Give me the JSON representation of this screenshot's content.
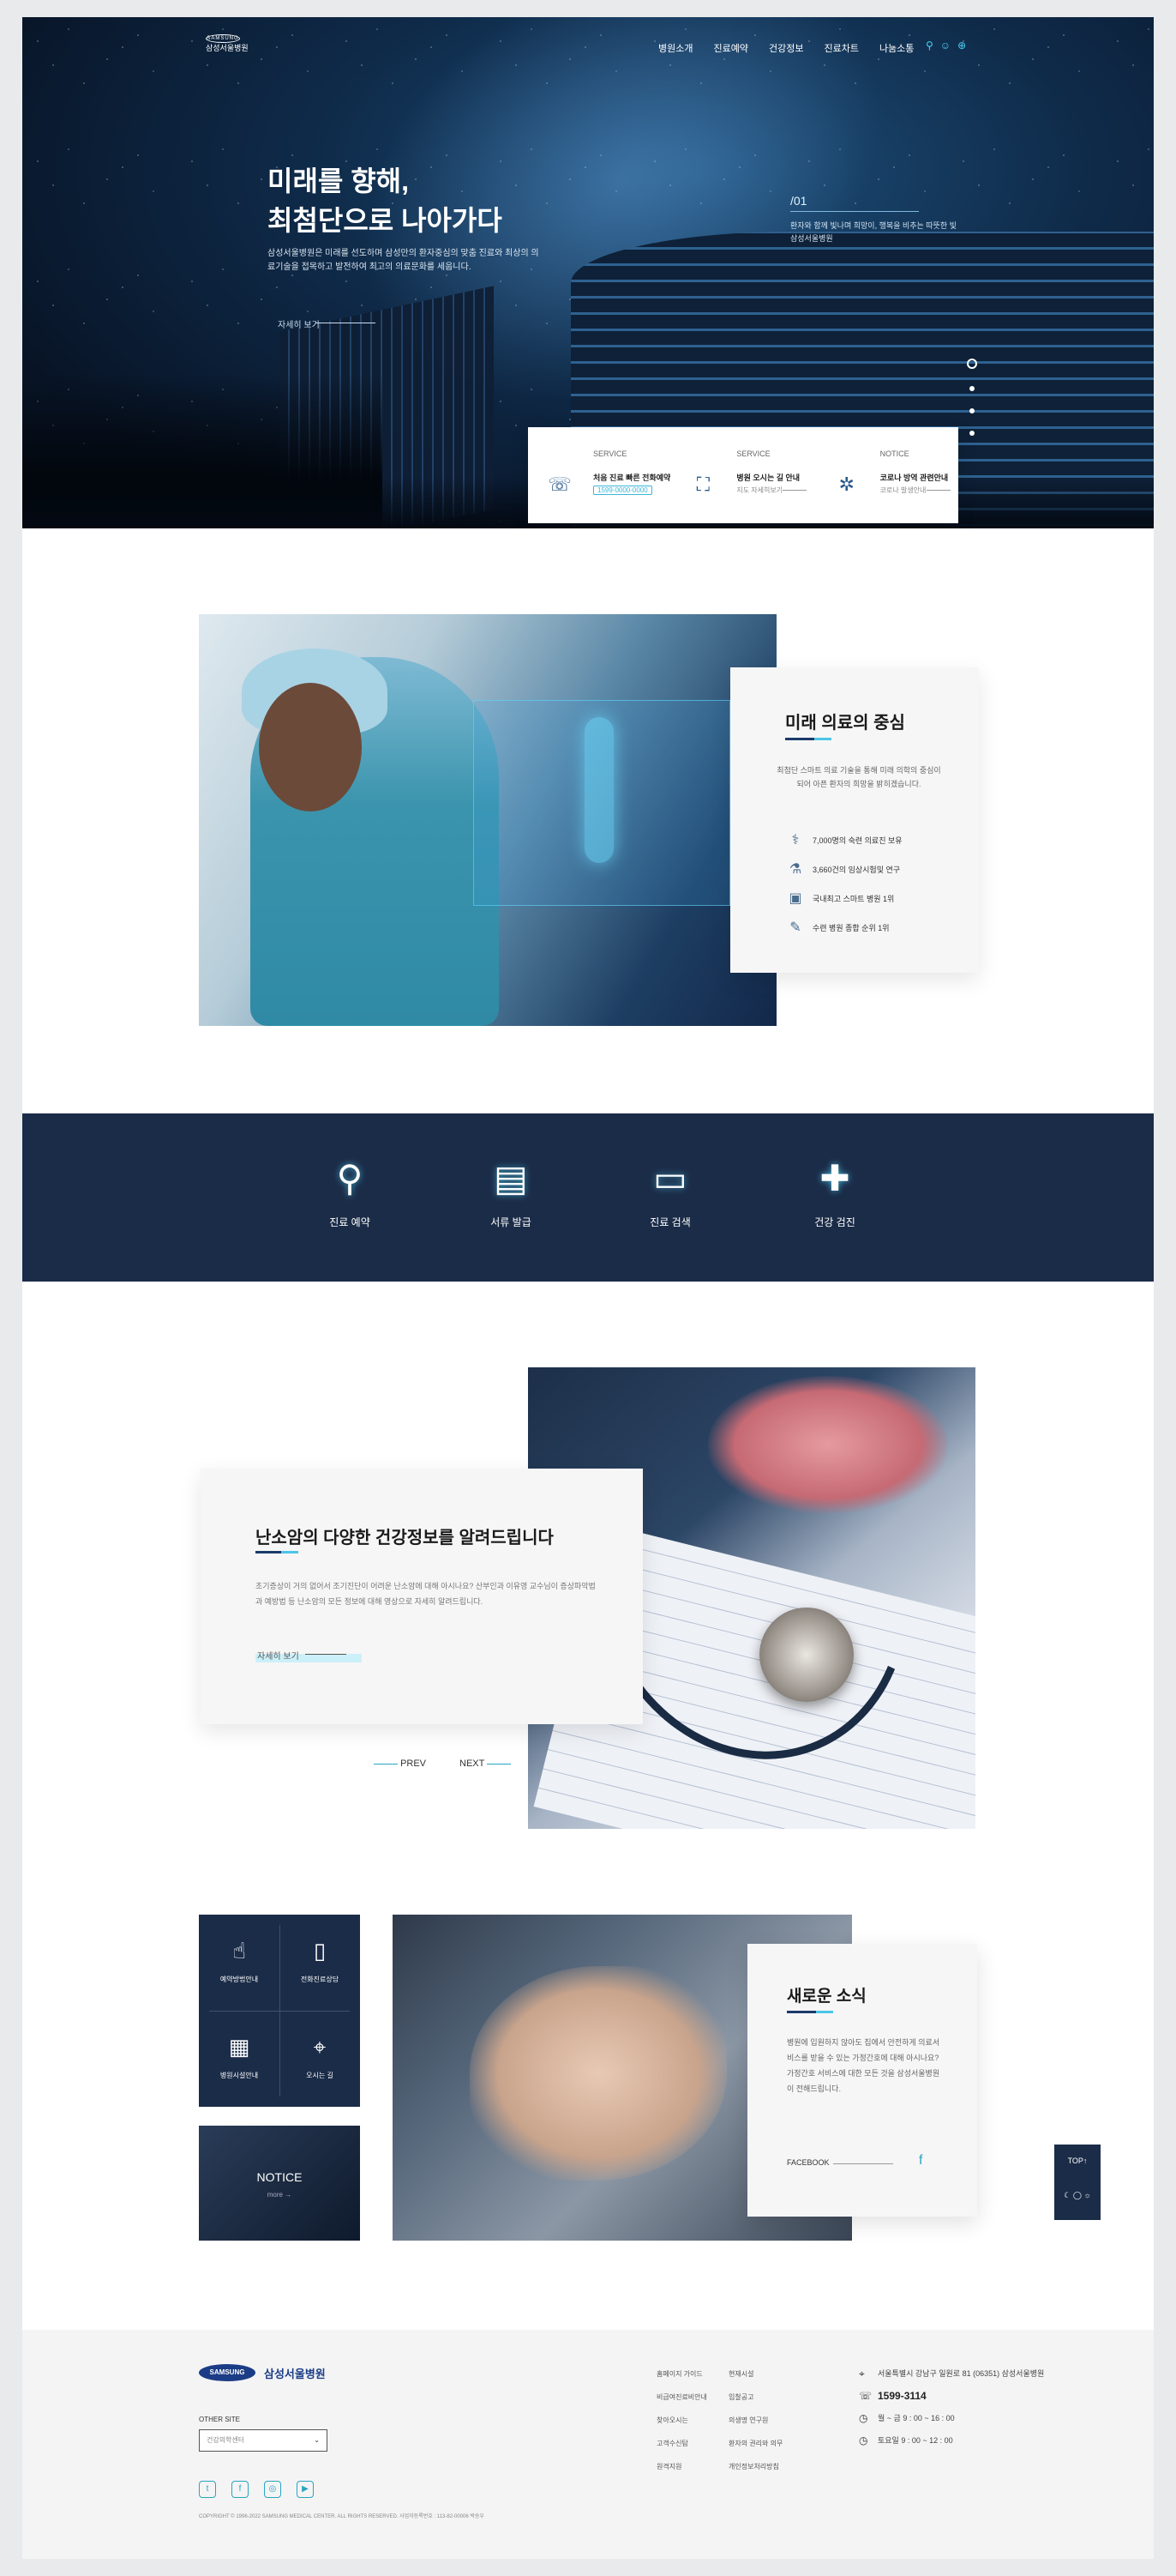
{
  "header": {
    "logo_text": "삼성서울병원",
    "logo_mark": "SAMSUNG",
    "nav": [
      "병원소개",
      "진료예약",
      "건강정보",
      "진료차트",
      "나눔소통"
    ],
    "util": [
      "search-icon",
      "user-icon",
      "globe-icon"
    ]
  },
  "hero": {
    "title": "미래를 향해,\n최첨단으로 나아가다",
    "desc": "삼성서울병원은 미래를 선도하며 삼성만의 환자중심의 맞춤 진료와 최상의 의료기술을 접목하고 발전하여 최고의 의료문화를 세웁니다.",
    "more": "자세히 보기",
    "slide_no": "01",
    "slide_text": "환자와 함께 빛나며 희망이, 행복을 비추는 따뜻한 빛 삼성서울병원",
    "dots": 4
  },
  "quick": [
    {
      "label": "SERVICE",
      "title": "처음 진료 빠른 전화예약",
      "sub": "1599-0000-0000",
      "icon": "phone-icon",
      "glyph": "☏"
    },
    {
      "label": "SERVICE",
      "title": "병원 오시는 길 안내",
      "sub": "지도 자세히보기",
      "icon": "map-icon",
      "glyph": "⛶"
    },
    {
      "label": "NOTICE",
      "title": "코로나 방역 관련안내",
      "sub": "코로나 발생안내",
      "icon": "virus-icon",
      "glyph": "✲"
    }
  ],
  "center": {
    "title": "미래 의료의 중심",
    "desc": "최첨단 스마트 의료 기술을 통해 미래 의학의 중심이 되어 아픈 환자의 희망을 밝히겠습니다.",
    "stats": [
      {
        "icon": "doctor-icon",
        "glyph": "⚕",
        "text": "7,000명의 숙련 의료진 보유"
      },
      {
        "icon": "research-icon",
        "glyph": "⚗",
        "text": "3,660건의 임상시험및 연구"
      },
      {
        "icon": "monitor-icon",
        "glyph": "▣",
        "text": "국내최고 스마트 병원 1위"
      },
      {
        "icon": "syringe-icon",
        "glyph": "✎",
        "text": "수련 병원 종합 순위 1위"
      }
    ]
  },
  "services": [
    {
      "icon": "stethoscope-icon",
      "glyph": "⚲",
      "label": "진료 예약"
    },
    {
      "icon": "clipboard-icon",
      "glyph": "▤",
      "label": "서류 발급"
    },
    {
      "icon": "monitor-pulse-icon",
      "glyph": "▭",
      "label": "진료 검색"
    },
    {
      "icon": "hand-cross-icon",
      "glyph": "✚",
      "label": "건강 검진"
    }
  ],
  "info": {
    "title": "난소암의 다양한 건강정보를 알려드립니다",
    "desc": "초기증상이 거의 없어서 조기진단이 어려운 난소암에 대해 아시나요? 산부인과 이유영 교수님이 증상파악법과 예방법 등 난소암의 모든 정보에 대해 영상으로 자세히 알려드립니다.",
    "more": "자세히 보기",
    "prev": "PREV",
    "next": "NEXT"
  },
  "quick_box": [
    {
      "icon": "click-icon",
      "glyph": "☝",
      "label": "예약방법안내"
    },
    {
      "icon": "mobile-icon",
      "glyph": "▯",
      "label": "전화진료상담"
    },
    {
      "icon": "hospital-icon",
      "glyph": "▦",
      "label": "병원시설안내"
    },
    {
      "icon": "location-icon",
      "glyph": "⌖",
      "label": "오시는 길"
    }
  ],
  "notice": {
    "title": "NOTICE",
    "more": "more →"
  },
  "news": {
    "title": "새로운 소식",
    "desc": "병원에 입원하지 않아도 집에서 안전하게 의료서비스를 받을 수 있는 가정간호에 대해 아시나요? 가정간호 서비스에 대한 모든 것을 삼성서울병원이 전해드립니다.",
    "link": "FACEBOOK"
  },
  "top_btn": {
    "label": "TOP↑",
    "toggle": "☾ ◯ ☼"
  },
  "footer": {
    "logo_mark": "SAMSUNG",
    "logo_name": "삼성서울병원",
    "other_site": "OTHER SITE",
    "select": "건강의학센터",
    "sns": [
      {
        "icon": "twitter-icon",
        "glyph": "t"
      },
      {
        "icon": "facebook-icon",
        "glyph": "f"
      },
      {
        "icon": "instagram-icon",
        "glyph": "◎"
      },
      {
        "icon": "youtube-icon",
        "glyph": "▶"
      }
    ],
    "copyright": "COPYRIGHT © 1996-2022 SAMSUNG MEDICAL CENTER. ALL RIGHTS RESERVED. 사업자등록번호 : 113-82-00006 박승우",
    "links": [
      "홈페이지 가이드",
      "현재시설",
      "비급여진료비안내",
      "입찰공고",
      "찾아오시는",
      "의생명 연구원",
      "고객수신탐",
      "환자의 권리와 의무",
      "원격지원",
      "개인정보처리방침"
    ],
    "address": "서울특별시 강남구 일원로 81 (06351) 삼성서울병원",
    "tel": "1599-3114",
    "hours1": "월 ~ 금   9 : 00 ~ 16 : 00",
    "hours2": "토요일   9 : 00 ~ 12 : 00"
  }
}
